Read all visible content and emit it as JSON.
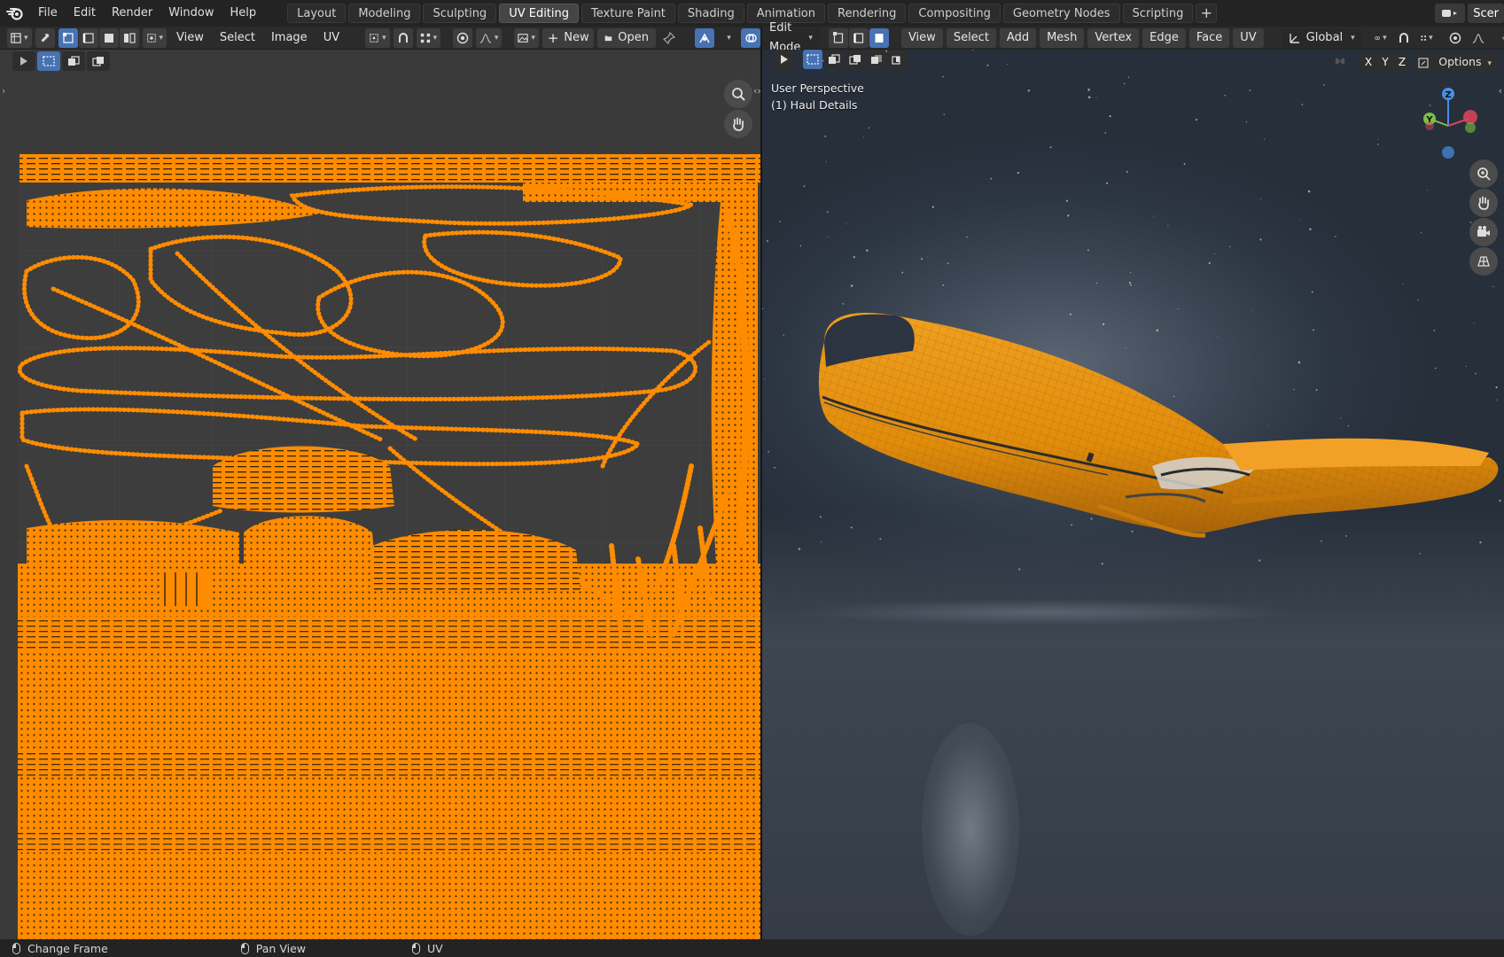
{
  "menubar": {
    "items": [
      "File",
      "Edit",
      "Render",
      "Window",
      "Help"
    ],
    "workspaces": [
      "Layout",
      "Modeling",
      "Sculpting",
      "UV Editing",
      "Texture Paint",
      "Shading",
      "Animation",
      "Rendering",
      "Compositing",
      "Geometry Nodes",
      "Scripting"
    ],
    "active_workspace": "UV Editing",
    "add_tab": "+",
    "scene_label": "Scer"
  },
  "uv_header": {
    "menus": [
      "View",
      "Select",
      "Image",
      "UV"
    ],
    "new_label": "New",
    "open_label": "Open",
    "new_icon": "+"
  },
  "viewport_header": {
    "mode": "Edit Mode",
    "menus": [
      "View",
      "Select",
      "Add",
      "Mesh",
      "Vertex",
      "Edge",
      "Face",
      "UV"
    ],
    "orientation": "Global",
    "options_label": "Options",
    "axes": [
      "X",
      "Y",
      "Z"
    ]
  },
  "viewport": {
    "perspective_label": "User Perspective",
    "object_label": "(1) Haul Details",
    "gizmo_axes": {
      "z": "Z",
      "y": "Y"
    }
  },
  "statusbar": {
    "items": [
      "Change Frame",
      "Pan View",
      "UV"
    ]
  },
  "colors": {
    "accent_blue": "#4772b3",
    "uv_orange": "#ff8c00",
    "mesh_orange": "#e8920e"
  }
}
